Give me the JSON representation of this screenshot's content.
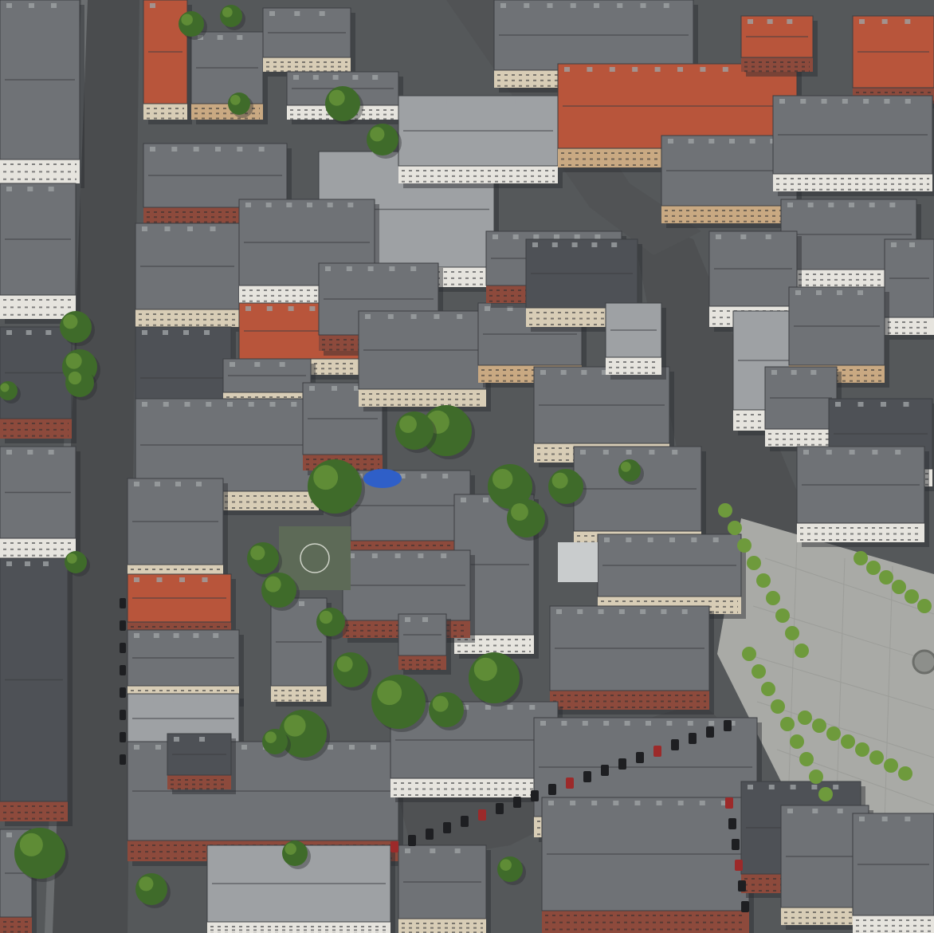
{
  "view": {
    "type": "aerial-3d-map",
    "has_text_labels": false,
    "palette": {
      "street": "#4a4c4e",
      "street_light": "#6b6e70",
      "plaza": "#a9aaa6",
      "plaza_tile": "#9c9d99",
      "roof_gray": "#6f7276",
      "roof_dark": "#4e5156",
      "roof_light": "#9ea1a4",
      "roof_red": "#b8553b",
      "roof_orange": "#d06a45",
      "facade_cream": "#d8cdb6",
      "facade_brick": "#8d4a3c",
      "facade_white": "#e6e4de",
      "facade_tan": "#c9a982",
      "tree": "#3f6b2a",
      "tree_light": "#6e9a3c",
      "court": "#5d6a57",
      "water_blue": "#2f5fc8",
      "shadow": "#2b2d30",
      "car": "#1e1f22"
    }
  }
}
